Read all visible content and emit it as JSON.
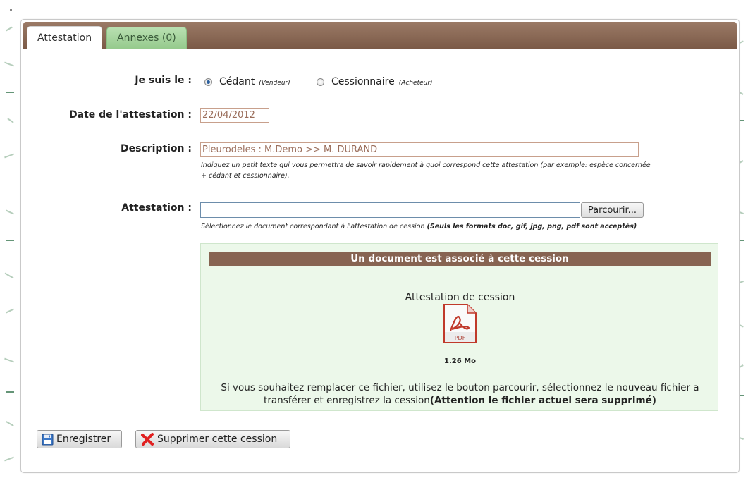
{
  "tabs": {
    "attestation": "Attestation",
    "annexes": "Annexes (0)"
  },
  "form": {
    "role_label": "Je suis le :",
    "role_options": [
      {
        "label": "Cédant",
        "sub": "(Vendeur)",
        "checked": true
      },
      {
        "label": "Cessionnaire",
        "sub": "(Acheteur)",
        "checked": false
      }
    ],
    "date_label": "Date de l'attestation :",
    "date_value": "22/04/2012",
    "description_label": "Description :",
    "description_value": "Pleurodeles : M.Demo >> M. DURAND",
    "description_hint_line1": "Indiquez un petit texte qui vous permettra de savoir rapidement à quoi correspond cette attestation (par exemple: espèce concernée",
    "description_hint_line2": "+ cédant et cessionnaire).",
    "attestation_label": "Attestation :",
    "attestation_value": "",
    "browse_label": "Parcourir...",
    "attestation_hint": "Sélectionnez le document correspondant à l'attestation de cession",
    "attestation_hint_bold": "(Seuls les formats doc, gif, jpg, png, pdf sont acceptés)"
  },
  "document": {
    "header": "Un document est associé à cette cession",
    "title": "Attestation de cession",
    "file_size": "1.26 Mo",
    "icon": "pdf-file-icon",
    "note": "Si vous souhaitez remplacer ce fichier, utilisez le bouton parcourir, sélectionnez le nouveau fichier a transférer et enregistrez la cession",
    "note_bold": "(Attention le fichier actuel sera supprimé)"
  },
  "actions": {
    "save_label": "Enregistrer",
    "save_icon": "floppy-disk-icon",
    "delete_label": "Supprimer cette cession",
    "delete_icon": "red-x-icon"
  },
  "colors": {
    "tabbar": "#876452",
    "inactive_tab": "#a8d8a0",
    "doc_box_bg": "#ecf8ea",
    "doc_header": "#876452"
  }
}
